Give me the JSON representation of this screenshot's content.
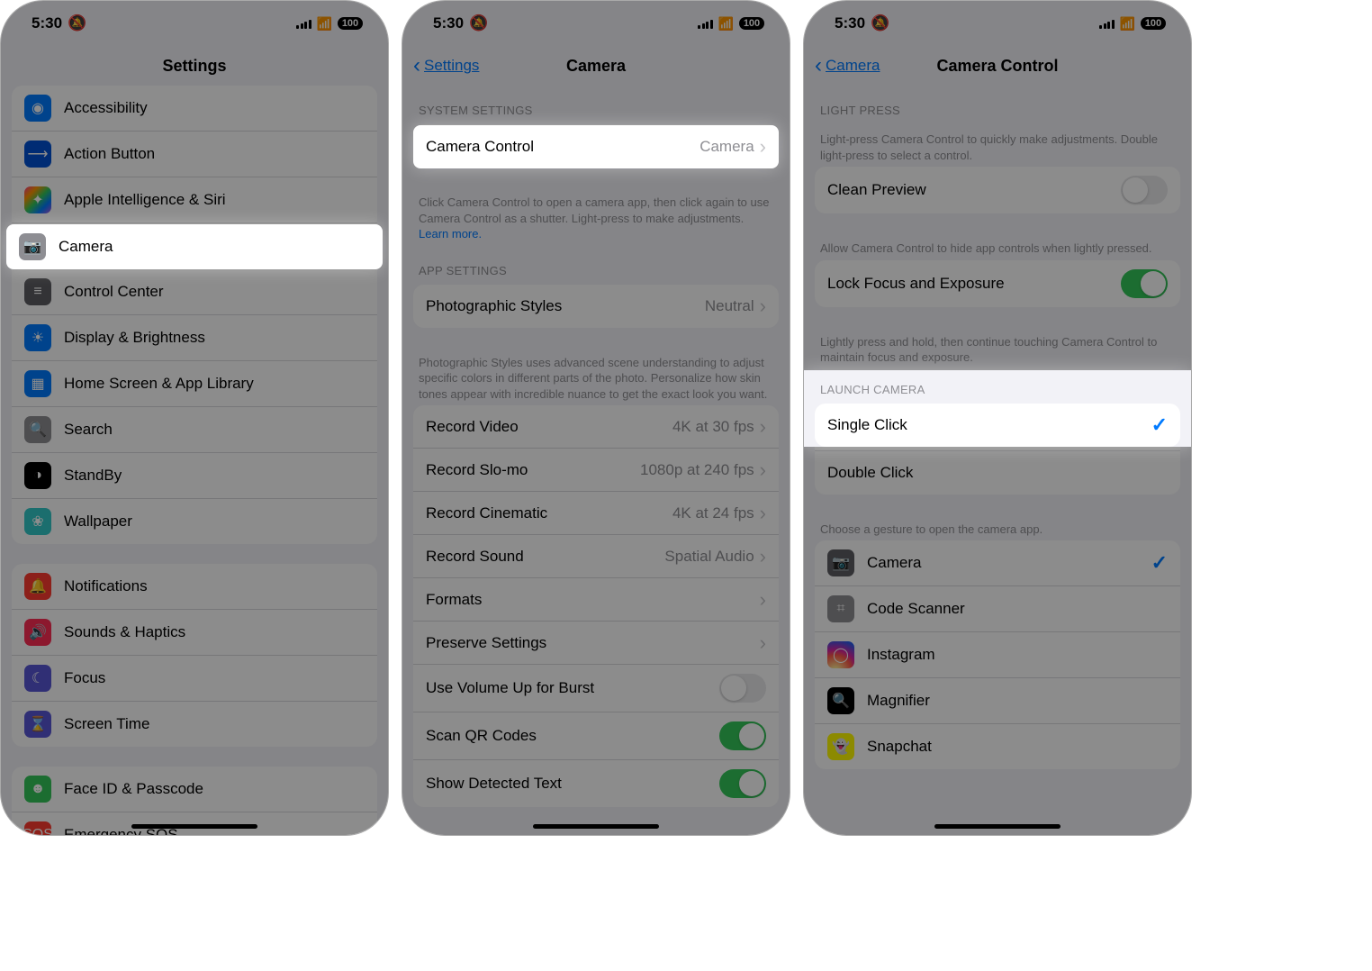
{
  "status": {
    "time": "5:30",
    "battery": "100"
  },
  "screen1": {
    "title": "Settings",
    "groups": [
      [
        {
          "icon": "c-blue",
          "glyph": "◉",
          "name": "Accessibility"
        },
        {
          "icon": "c-bluedk",
          "glyph": "⟶",
          "name": "Action Button"
        },
        {
          "icon": "c-gradient",
          "glyph": "✦",
          "name": "Apple Intelligence & Siri"
        },
        {
          "icon": "c-grey",
          "glyph": "📷",
          "name": "Camera",
          "highlight": true
        },
        {
          "icon": "c-greydk",
          "glyph": "≡",
          "name": "Control Center"
        },
        {
          "icon": "c-blue",
          "glyph": "☀",
          "name": "Display & Brightness"
        },
        {
          "icon": "c-blue",
          "glyph": "▦",
          "name": "Home Screen & App Library"
        },
        {
          "icon": "c-grey",
          "glyph": "🔍",
          "name": "Search"
        },
        {
          "icon": "c-black",
          "glyph": "◑",
          "name": "StandBy"
        },
        {
          "icon": "c-teal",
          "glyph": "❀",
          "name": "Wallpaper"
        }
      ],
      [
        {
          "icon": "c-red",
          "glyph": "🔔",
          "name": "Notifications"
        },
        {
          "icon": "c-redpk",
          "glyph": "🔊",
          "name": "Sounds & Haptics"
        },
        {
          "icon": "c-purple",
          "glyph": "☾",
          "name": "Focus"
        },
        {
          "icon": "c-purple",
          "glyph": "⌛",
          "name": "Screen Time"
        }
      ],
      [
        {
          "icon": "c-green",
          "glyph": "☻",
          "name": "Face ID & Passcode"
        },
        {
          "icon": "c-red",
          "glyph": "SOS",
          "name": "Emergency SOS"
        }
      ]
    ]
  },
  "screen2": {
    "back": "Settings",
    "title": "Camera",
    "sections": [
      {
        "header": "SYSTEM SETTINGS",
        "rows": [
          {
            "label": "Camera Control",
            "value": "Camera",
            "chevron": true,
            "highlight": true
          }
        ],
        "footer": "Click Camera Control to open a camera app, then click again to use Camera Control as a shutter. Light-press to make adjustments.",
        "footerLink": "Learn more."
      },
      {
        "header": "APP SETTINGS",
        "rows": [
          {
            "label": "Photographic Styles",
            "value": "Neutral",
            "chevron": true
          }
        ],
        "footer": "Photographic Styles uses advanced scene understanding to adjust specific colors in different parts of the photo. Personalize how skin tones appear with incredible nuance to get the exact look you want."
      },
      {
        "rows": [
          {
            "label": "Record Video",
            "value": "4K at 30 fps",
            "chevron": true
          },
          {
            "label": "Record Slo-mo",
            "value": "1080p at 240 fps",
            "chevron": true
          },
          {
            "label": "Record Cinematic",
            "value": "4K at 24 fps",
            "chevron": true
          },
          {
            "label": "Record Sound",
            "value": "Spatial Audio",
            "chevron": true
          },
          {
            "label": "Formats",
            "chevron": true
          },
          {
            "label": "Preserve Settings",
            "chevron": true
          },
          {
            "label": "Use Volume Up for Burst",
            "toggle": "off"
          },
          {
            "label": "Scan QR Codes",
            "toggle": "on"
          },
          {
            "label": "Show Detected Text",
            "toggle": "on"
          }
        ]
      }
    ]
  },
  "screen3": {
    "back": "Camera",
    "title": "Camera Control",
    "sections": [
      {
        "header": "LIGHT PRESS",
        "footer": "Light-press Camera Control to quickly make adjustments. Double light-press to select a control."
      },
      {
        "rows": [
          {
            "label": "Clean Preview",
            "toggle": "off"
          }
        ],
        "footer": "Allow Camera Control to hide app controls when lightly pressed."
      },
      {
        "rows": [
          {
            "label": "Lock Focus and Exposure",
            "toggle": "on"
          }
        ],
        "footer": "Lightly press and hold, then continue touching Camera Control to maintain focus and exposure."
      },
      {
        "header": "LAUNCH CAMERA",
        "highlightHeader": true,
        "rows": [
          {
            "label": "Single Click",
            "check": true,
            "highlight": true
          },
          {
            "label": "Double Click"
          }
        ],
        "footer": "Choose a gesture to open the camera app."
      },
      {
        "rows": [
          {
            "icon": "c-greydk",
            "glyph": "📷",
            "label": "Camera",
            "check": true
          },
          {
            "icon": "c-grey",
            "glyph": "⌗",
            "label": "Code Scanner"
          },
          {
            "icon": "c-insta",
            "glyph": "◯",
            "label": "Instagram"
          },
          {
            "icon": "c-magn",
            "glyph": "🔍",
            "label": "Magnifier"
          },
          {
            "icon": "c-snap",
            "glyph": "👻",
            "label": "Snapchat"
          }
        ]
      }
    ]
  }
}
